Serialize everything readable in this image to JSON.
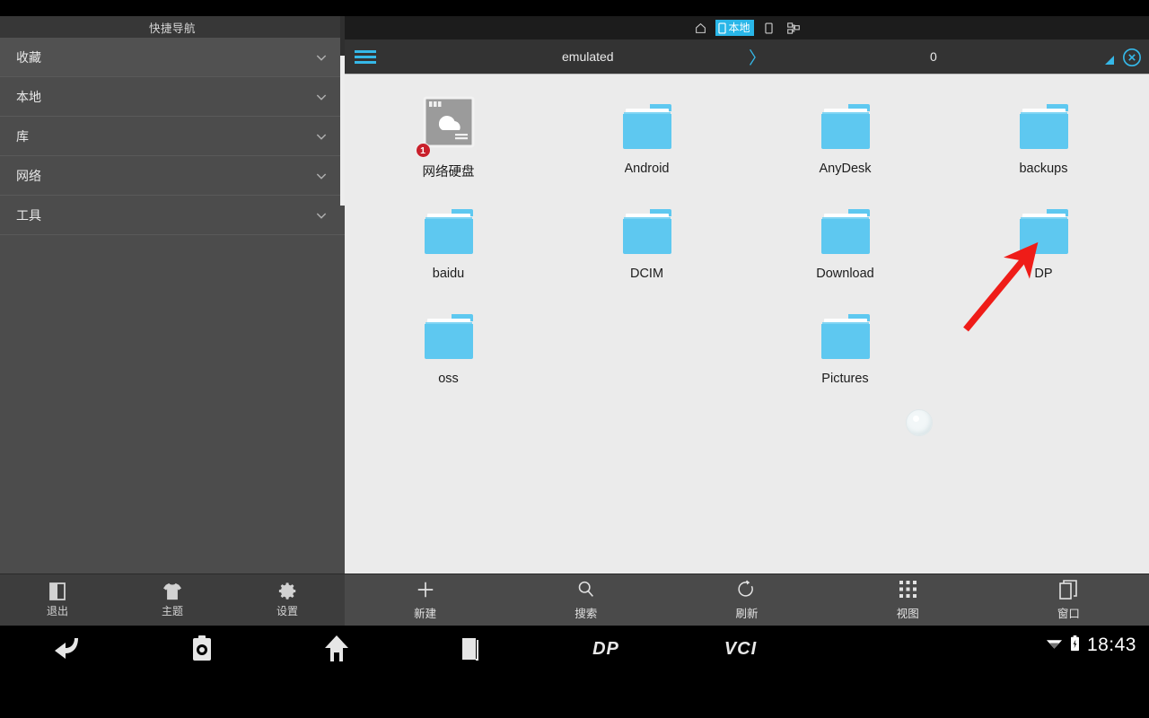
{
  "colors": {
    "accent": "#35b8e8",
    "folder": "#5ec8f0",
    "sidebar_bg": "#4c4c4c",
    "content_bg": "#ebebeb",
    "badge_red": "#c9202b",
    "arrow_red": "#ef1c18"
  },
  "sidebar": {
    "title": "快捷导航",
    "items": [
      {
        "label": "收藏",
        "icon": "chevron-down-icon"
      },
      {
        "label": "本地",
        "icon": "chevron-down-icon"
      },
      {
        "label": "库",
        "icon": "chevron-down-icon"
      },
      {
        "label": "网络",
        "icon": "chevron-down-icon"
      },
      {
        "label": "工具",
        "icon": "chevron-down-icon"
      }
    ],
    "bottom_buttons": [
      {
        "label": "退出",
        "icon": "exit-door-icon"
      },
      {
        "label": "主题",
        "icon": "tshirt-icon"
      },
      {
        "label": "设置",
        "icon": "gear-icon"
      }
    ]
  },
  "tabstrip": {
    "home_icon": "home-icon",
    "active_tab": {
      "label": "本地",
      "icon": "phone-icon"
    },
    "tabs": [
      {
        "icon": "phone-icon"
      },
      {
        "icon": "network-share-icon"
      }
    ]
  },
  "addressbar": {
    "menu_icon": "hamburger-menu-icon",
    "crumb_1": "emulated",
    "separator": "〉",
    "crumb_2": "0",
    "resize_icon": "resize-handle-icon",
    "close_icon": "close-circle-icon"
  },
  "files": [
    {
      "name": "网络硬盘",
      "type": "network-drive",
      "badge": "1"
    },
    {
      "name": "Android",
      "type": "folder",
      "badge": ""
    },
    {
      "name": "AnyDesk",
      "type": "folder",
      "badge": ""
    },
    {
      "name": "backups",
      "type": "folder",
      "badge": ""
    },
    {
      "name": "baidu",
      "type": "folder",
      "badge": ""
    },
    {
      "name": "DCIM",
      "type": "folder",
      "badge": ""
    },
    {
      "name": "Download",
      "type": "folder",
      "badge": ""
    },
    {
      "name": "DP",
      "type": "folder",
      "badge": ""
    },
    {
      "name": "oss",
      "type": "folder",
      "badge": ""
    },
    {
      "name": "",
      "type": "loading",
      "badge": ""
    },
    {
      "name": "Pictures",
      "type": "folder",
      "badge": ""
    }
  ],
  "pane_toolbar": [
    {
      "label": "新建",
      "icon": "plus-icon"
    },
    {
      "label": "搜索",
      "icon": "search-icon"
    },
    {
      "label": "刷新",
      "icon": "refresh-icon"
    },
    {
      "label": "视图",
      "icon": "grid-view-icon"
    },
    {
      "label": "窗口",
      "icon": "window-copy-icon"
    }
  ],
  "navbar": {
    "buttons": [
      {
        "icon": "back-arrow-icon",
        "label": ""
      },
      {
        "icon": "camera-icon",
        "label": ""
      },
      {
        "icon": "home-icon",
        "label": ""
      },
      {
        "icon": "recents-icon",
        "label": ""
      },
      {
        "icon": "dp-wordmark",
        "label": "DP"
      },
      {
        "icon": "vci-wordmark",
        "label": "VCI"
      }
    ],
    "status": {
      "wifi_icon": "wifi-icon",
      "battery_icon": "battery-charging-icon",
      "time": "18:43"
    }
  },
  "annotation": {
    "arrow_icon": "red-arrow-pointer",
    "points_to": "DP"
  }
}
